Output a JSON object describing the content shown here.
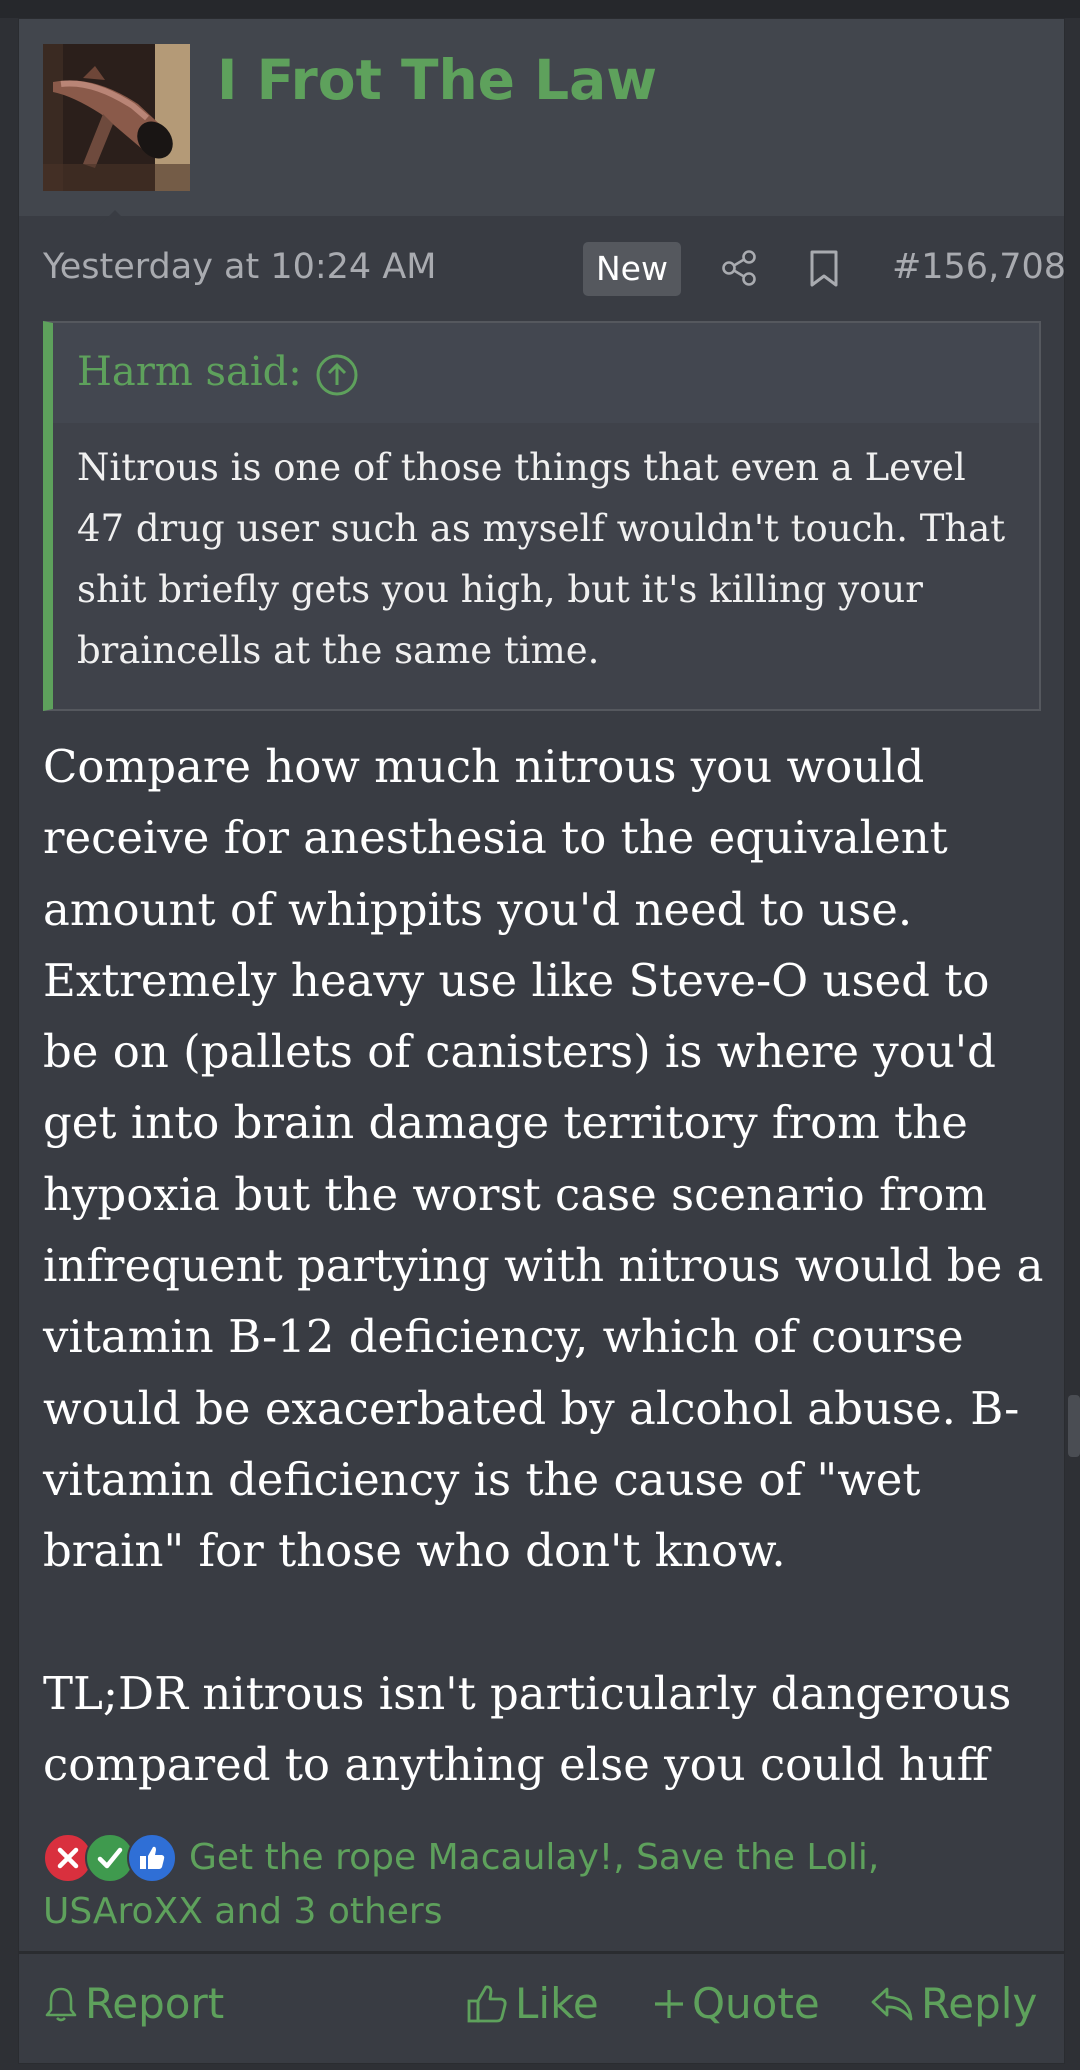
{
  "post": {
    "username": "I Frot The Law",
    "timestamp": "Yesterday at 10:24 AM",
    "badge": "New",
    "post_number": "#156,708",
    "quote": {
      "author": "Harm said:",
      "text": "Nitrous is one of those things that even a Level 47 drug user such as myself wouldn't touch. That shit briefly gets you high, but it's killing your braincells at the same time."
    },
    "body": {
      "paragraph1": "Compare how much nitrous you would receive for anesthesia to the equivalent amount of whippits you'd need to use. Extremely heavy use like Steve-O used to be on (pallets of canisters) is where you'd get into brain damage territory from the hypoxia but the worst case scenario from infrequent partying with nitrous would be a vitamin B-12 deficiency, which of course would be exacerbated by alcohol abuse. B-vitamin deficiency is the cause of \"wet brain\" for those who don't know.",
      "paragraph2": "TL;DR nitrous isn't particularly dangerous compared to anything else you could huff"
    },
    "reactions": {
      "text": "Get the rope Macaulay!, Save the Loli, USAroXX and 3 others",
      "icons": [
        "x-reaction-icon",
        "check-reaction-icon",
        "thumbs-up-reaction-icon"
      ]
    },
    "actions": {
      "report": "Report",
      "like": "Like",
      "quote": "Quote",
      "reply": "Reply"
    }
  },
  "colors": {
    "accent": "#5ea15c",
    "background": "#393c43",
    "header": "#42464d",
    "muted_text": "#a9abb0"
  }
}
